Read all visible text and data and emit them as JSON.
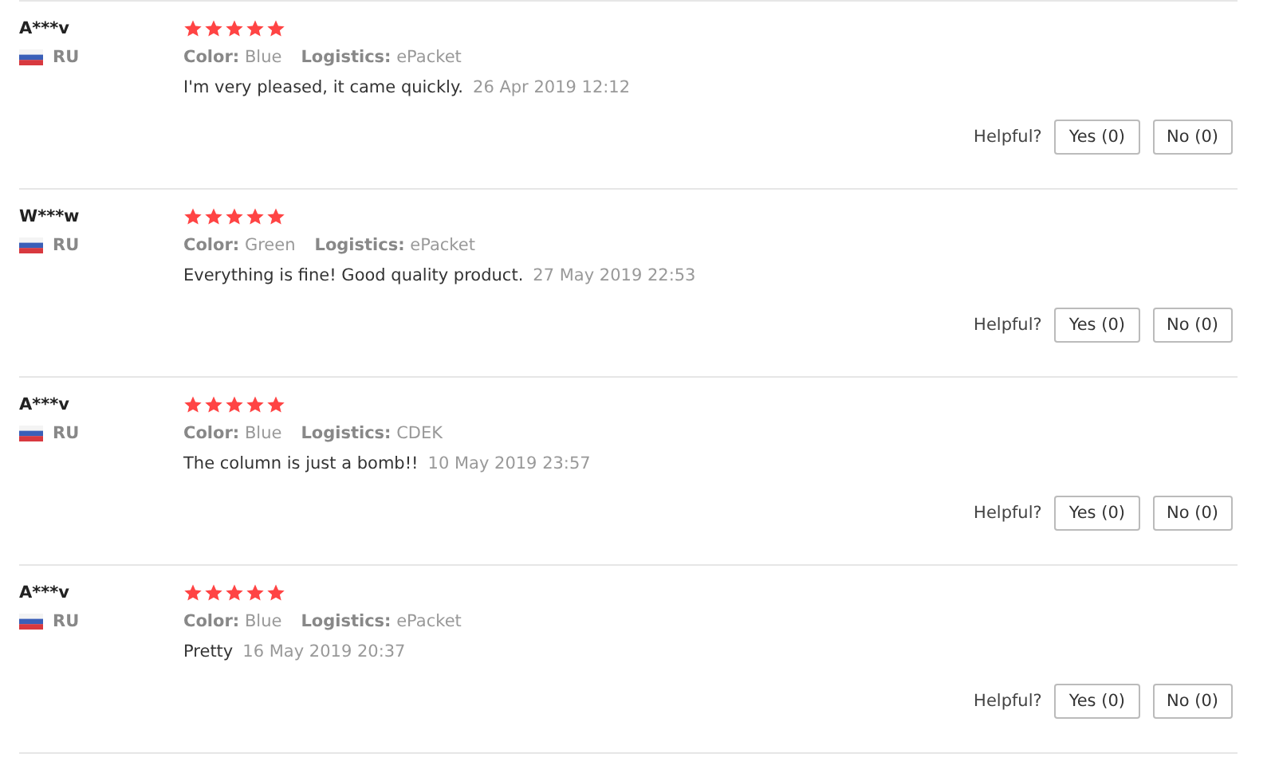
{
  "reviews": [
    {
      "user": "A***v",
      "country": "RU",
      "stars": 5,
      "properties": [
        "**Color:** Blue",
        "**Logistics:** ePacket"
      ],
      "text": "I'm very pleased, it came quickly.",
      "date": "26 Apr 2019 12:12",
      "helpful_label": "Helpful?",
      "yes": "Yes (0)",
      "no": "No (0)"
    },
    {
      "user": "W***w",
      "country": "RU",
      "stars": 5,
      "properties": [
        "**Color:** Green",
        "**Logistics:** ePacket"
      ],
      "text": "Everything is fine! Good quality product.",
      "date": "27 May 2019 22:53",
      "helpful_label": "Helpful?",
      "yes": "Yes (0)",
      "no": "No (0)"
    },
    {
      "user": "A***v",
      "country": "RU",
      "stars": 5,
      "properties": [
        "**Color:** Blue",
        "**Logistics:** CDEK"
      ],
      "text": "The column is just a bomb!!",
      "date": "10 May 2019 23:57",
      "helpful_label": "Helpful?",
      "yes": "Yes (0)",
      "no": "No (0)"
    },
    {
      "user": "A***v",
      "country": "RU",
      "stars": 5,
      "properties": [
        "**Color:** Blue",
        "**Logistics:** ePacket"
      ],
      "text": "Pretty",
      "date": "16 May 2019 20:37",
      "helpful_label": "Helpful?",
      "yes": "Yes (0)",
      "no": "No (0)"
    }
  ]
}
